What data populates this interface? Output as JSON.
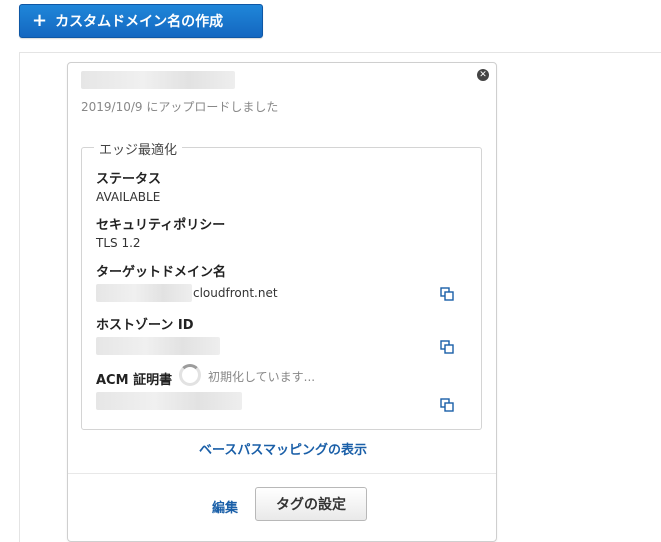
{
  "toolbar": {
    "create_label": "カスタムドメイン名の作成"
  },
  "card": {
    "uploaded_text": "2019/10/9 にアップロードしました",
    "section_title": "エッジ最適化",
    "status_label": "ステータス",
    "status_value": "AVAILABLE",
    "policy_label": "セキュリティポリシー",
    "policy_value": "TLS 1.2",
    "target_label": "ターゲットドメイン名",
    "target_value_suffix": "cloudfront.net",
    "zone_label": "ホストゾーン ID",
    "acm_label": "ACM 証明書",
    "acm_status": "初期化しています...",
    "mapping_link": "ベースパスマッピングの表示",
    "edit_link": "編集",
    "tag_button": "タグの設定"
  },
  "icons": [
    "plus-icon",
    "close-icon",
    "copy-icon",
    "spinner-icon"
  ],
  "colors": {
    "primary": "#1a6fcf",
    "link": "#1a5fa8"
  }
}
